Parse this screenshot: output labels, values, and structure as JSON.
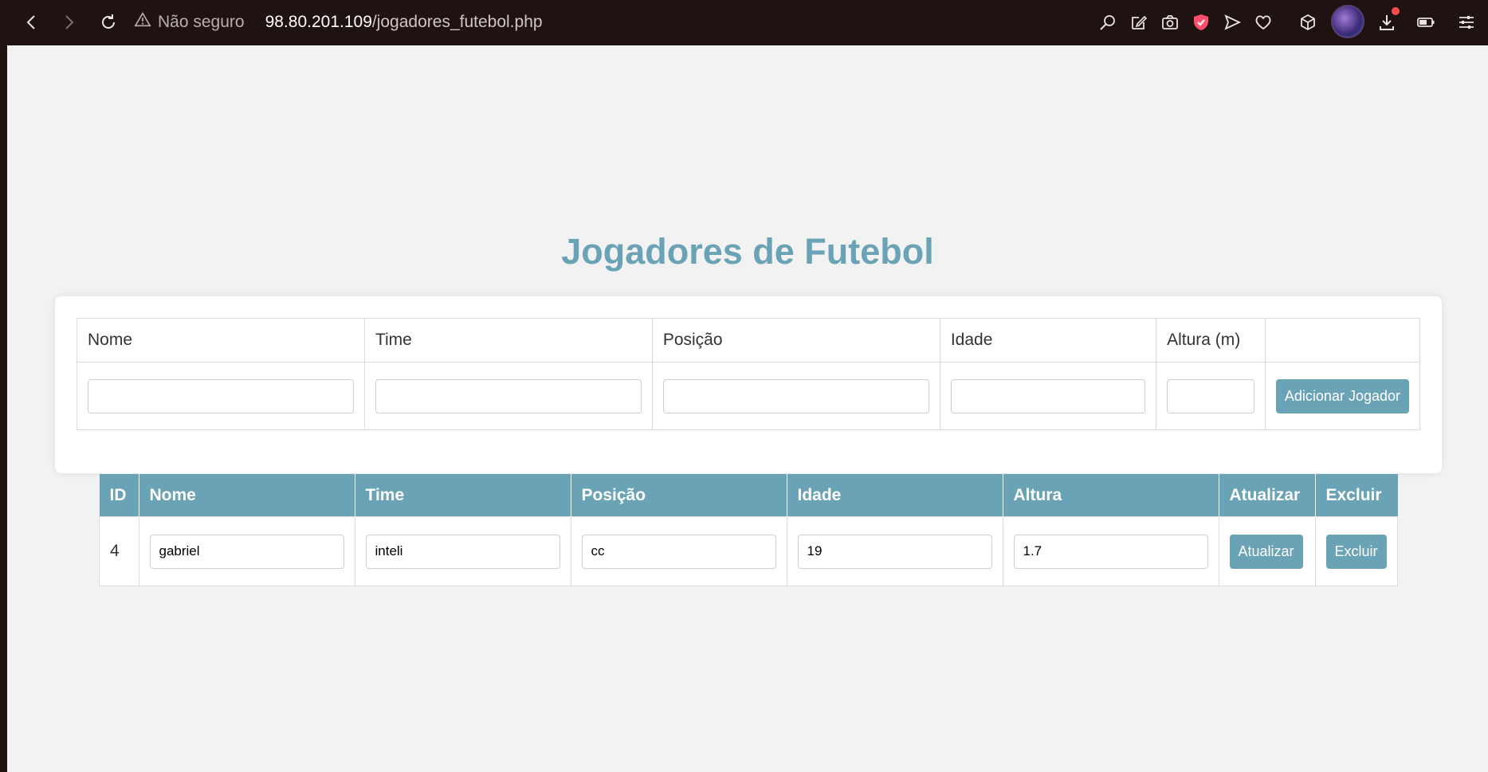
{
  "browser": {
    "security_label": "Não seguro",
    "url_host": "98.80.201.109",
    "url_path": "/jogadores_futebol.php",
    "icons": [
      "back-icon",
      "forward-icon",
      "reload-icon",
      "warning-icon",
      "search-page-icon",
      "edit-icon",
      "camera-icon",
      "shield-icon",
      "send-icon",
      "heart-icon",
      "extensions-cube-icon",
      "avatar",
      "download-icon",
      "battery-icon",
      "menu-sliders-icon"
    ],
    "accent_colors": {
      "chrome": "#1f1312",
      "notification_dot": "#ff4d4d",
      "shield": "#ff4d6d"
    }
  },
  "page": {
    "title": "Jogadores de Futebol",
    "accent_color": "#6aa3b5",
    "background": "#f2f2f2"
  },
  "form": {
    "headers": [
      "Nome",
      "Time",
      "Posição",
      "Idade",
      "Altura (m)",
      ""
    ],
    "inputs": {
      "nome": "",
      "time": "",
      "posicao": "",
      "idade": "",
      "altura": ""
    },
    "submit_label": "Adicionar Jogador"
  },
  "players_table": {
    "headers": [
      "ID",
      "Nome",
      "Time",
      "Posição",
      "Idade",
      "Altura",
      "Atualizar",
      "Excluir"
    ],
    "rows": [
      {
        "id": "4",
        "nome": "gabriel",
        "time": "inteli",
        "posicao": "cc",
        "idade": "19",
        "altura": "1.7",
        "update_label": "Atualizar",
        "delete_label": "Excluir"
      }
    ]
  }
}
